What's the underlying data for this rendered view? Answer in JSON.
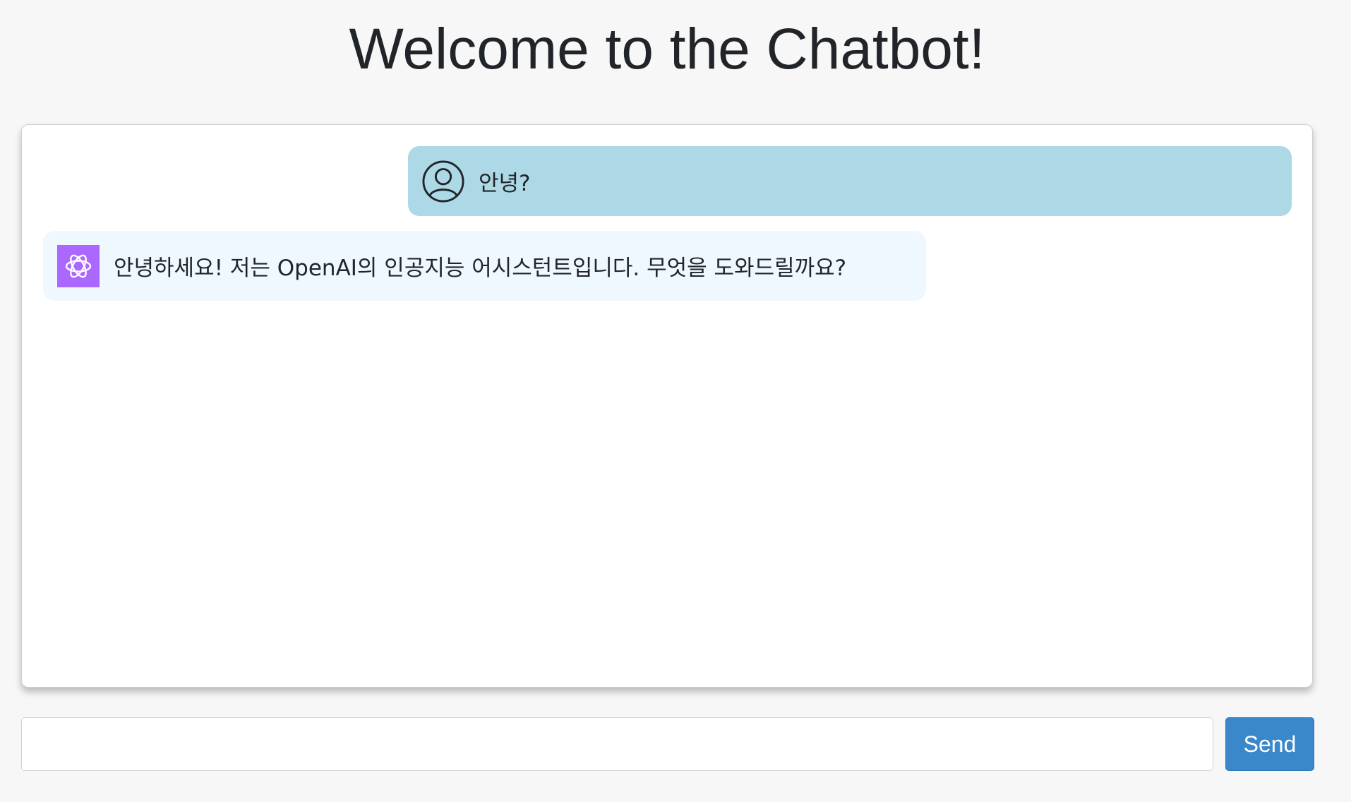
{
  "header": {
    "title": "Welcome to the Chatbot!"
  },
  "chat": {
    "messages": [
      {
        "role": "user",
        "avatar_icon": "user-circle-icon",
        "text": "안녕?",
        "bubble_color": "#add8e6"
      },
      {
        "role": "assistant",
        "avatar_icon": "openai-logo-icon",
        "avatar_color": "#ab68ff",
        "text": "안녕하세요! 저는 OpenAI의 인공지능 어시스턴트입니다. 무엇을 도와드릴까요?",
        "bubble_color": "#f0f8ff"
      }
    ]
  },
  "composer": {
    "input_value": "",
    "input_placeholder": "",
    "send_label": "Send",
    "send_color": "#3a87c9"
  }
}
